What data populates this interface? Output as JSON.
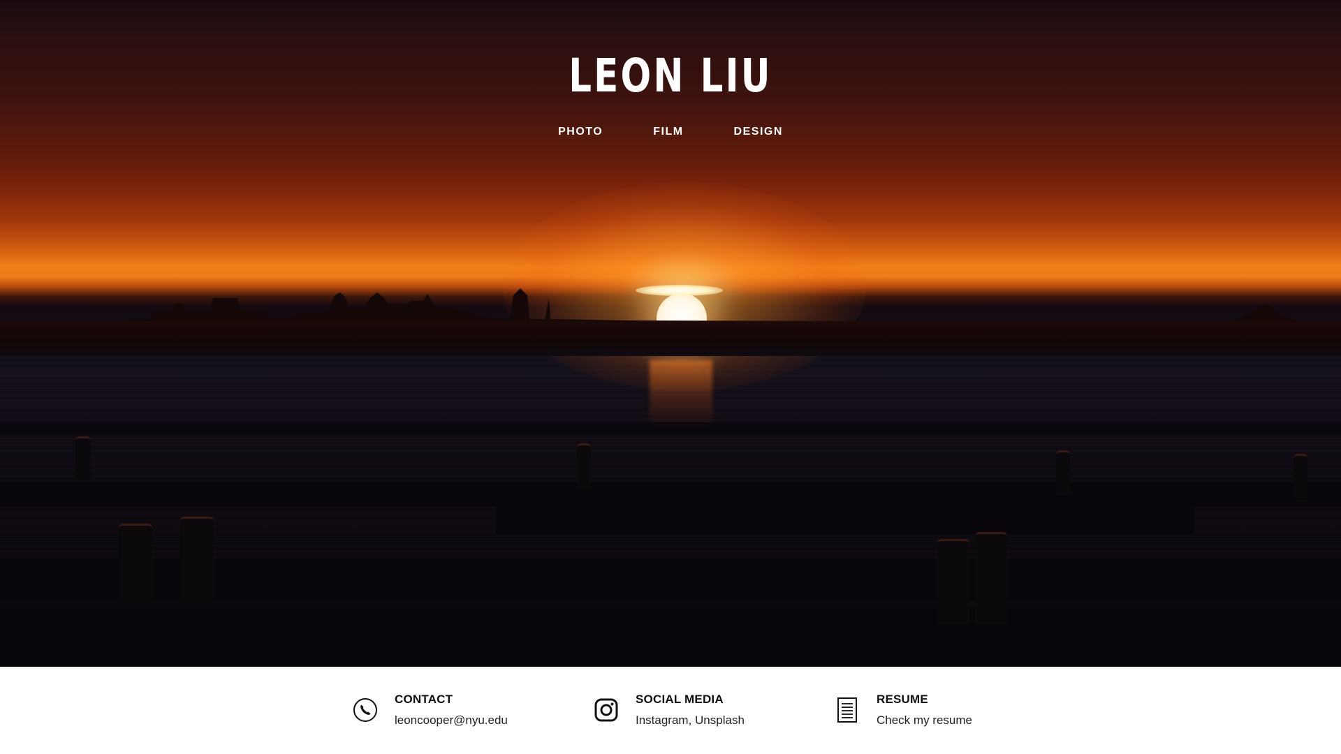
{
  "site": {
    "title": "LEON LIU"
  },
  "nav": {
    "items": [
      {
        "label": "PHOTO"
      },
      {
        "label": "FILM"
      },
      {
        "label": "DESIGN"
      }
    ]
  },
  "footer": {
    "contact": {
      "label": "CONTACT",
      "value": "leoncooper@nyu.edu",
      "icon": "phone-icon"
    },
    "social": {
      "label": "SOCIAL MEDIA",
      "value": "Instagram, Unsplash",
      "icon": "instagram-icon"
    },
    "resume": {
      "label": "RESUME",
      "value": "Check my resume",
      "icon": "document-icon"
    }
  },
  "colors": {
    "sky_top": "#1a0b0f",
    "sunset_orange": "#f1801a",
    "footer_bg": "#ffffff",
    "text_dark": "#111111"
  }
}
